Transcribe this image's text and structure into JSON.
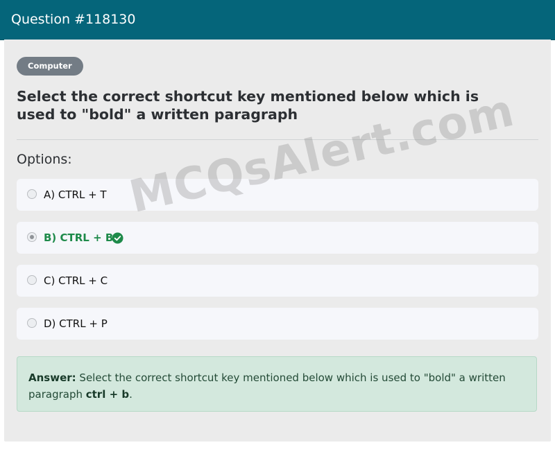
{
  "header": {
    "title": "Question #118130"
  },
  "category": "Computer",
  "question": "Select the correct shortcut key mentioned below which is used to \"bold\" a written paragraph",
  "options_label": "Options:",
  "options": [
    {
      "label": "A) CTRL + T",
      "selected": false,
      "correct": false
    },
    {
      "label": "B) CTRL + B",
      "selected": true,
      "correct": true
    },
    {
      "label": "C) CTRL + C",
      "selected": false,
      "correct": false
    },
    {
      "label": "D) CTRL + P",
      "selected": false,
      "correct": false
    }
  ],
  "answer": {
    "prefix": "Answer:",
    "text": " Select the correct shortcut key mentioned below which is used to \"bold\" a written paragraph ",
    "key": "ctrl + b",
    "suffix": "."
  },
  "watermark": "MCQsAlert.com",
  "colors": {
    "header_bg": "#05657a",
    "correct": "#1e8a4a",
    "answer_bg": "#d3e8dd"
  }
}
